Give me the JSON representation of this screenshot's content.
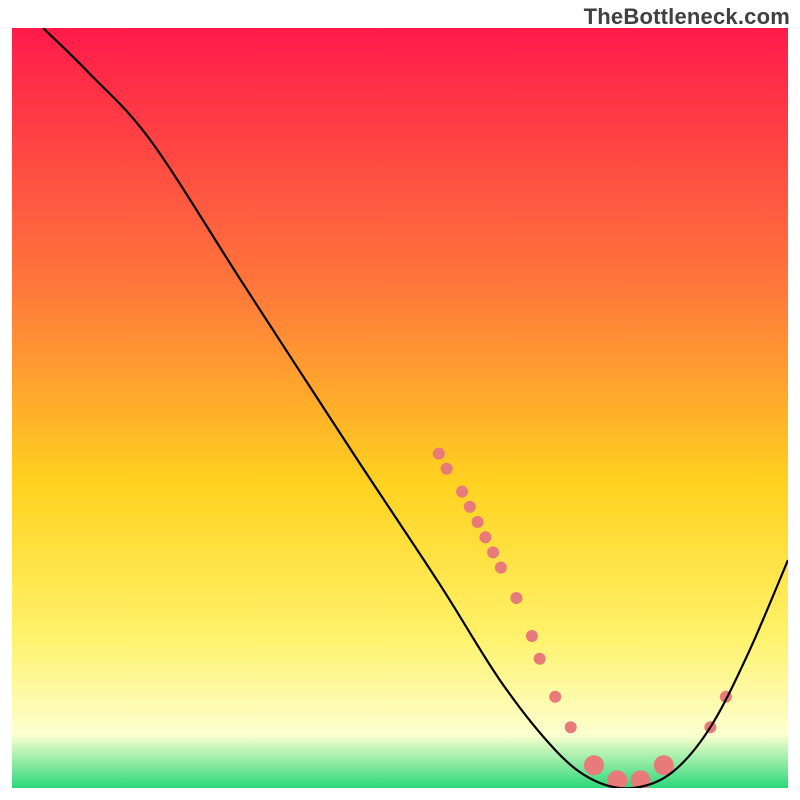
{
  "watermark": "TheBottleneck.com",
  "chart_data": {
    "type": "line",
    "title": "",
    "xlabel": "",
    "ylabel": "",
    "xlim": [
      0,
      100
    ],
    "ylim": [
      0,
      100
    ],
    "grid": false,
    "legend": false,
    "gradient_stops": [
      {
        "offset": 0.0,
        "color": "#ff1a4b"
      },
      {
        "offset": 0.35,
        "color": "#ff7a3a"
      },
      {
        "offset": 0.6,
        "color": "#ffd21f"
      },
      {
        "offset": 0.8,
        "color": "#fff26a"
      },
      {
        "offset": 0.93,
        "color": "#fcffcf"
      },
      {
        "offset": 1.0,
        "color": "#2bd87a"
      }
    ],
    "series": [
      {
        "name": "curve",
        "type": "line",
        "color": "#000000",
        "points": [
          {
            "x": 4,
            "y": 100
          },
          {
            "x": 10,
            "y": 94
          },
          {
            "x": 18,
            "y": 85
          },
          {
            "x": 30,
            "y": 66
          },
          {
            "x": 44,
            "y": 44
          },
          {
            "x": 55,
            "y": 27
          },
          {
            "x": 63,
            "y": 14
          },
          {
            "x": 70,
            "y": 5
          },
          {
            "x": 75,
            "y": 1
          },
          {
            "x": 80,
            "y": 0
          },
          {
            "x": 85,
            "y": 2
          },
          {
            "x": 90,
            "y": 8
          },
          {
            "x": 95,
            "y": 18
          },
          {
            "x": 100,
            "y": 30
          }
        ]
      },
      {
        "name": "small-dots",
        "type": "scatter",
        "color": "#e97a7a",
        "radius": 6,
        "points": [
          {
            "x": 55,
            "y": 44
          },
          {
            "x": 56,
            "y": 42
          },
          {
            "x": 58,
            "y": 39
          },
          {
            "x": 59,
            "y": 37
          },
          {
            "x": 60,
            "y": 35
          },
          {
            "x": 61,
            "y": 33
          },
          {
            "x": 62,
            "y": 31
          },
          {
            "x": 63,
            "y": 29
          },
          {
            "x": 65,
            "y": 25
          },
          {
            "x": 67,
            "y": 20
          },
          {
            "x": 68,
            "y": 17
          },
          {
            "x": 70,
            "y": 12
          },
          {
            "x": 72,
            "y": 8
          },
          {
            "x": 90,
            "y": 8
          },
          {
            "x": 92,
            "y": 12
          }
        ]
      },
      {
        "name": "large-dots",
        "type": "scatter",
        "color": "#e97a7a",
        "radius": 10,
        "points": [
          {
            "x": 75,
            "y": 3
          },
          {
            "x": 78,
            "y": 1
          },
          {
            "x": 81,
            "y": 1
          },
          {
            "x": 84,
            "y": 3
          }
        ]
      }
    ]
  }
}
